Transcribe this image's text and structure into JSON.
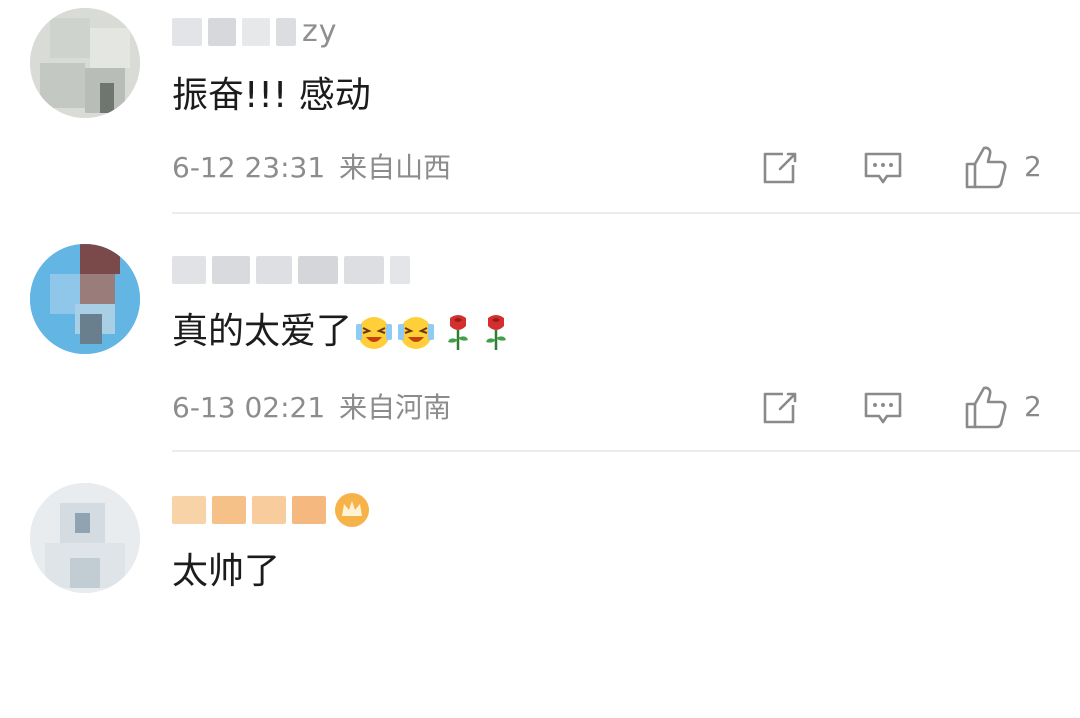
{
  "comments": [
    {
      "username_visible_suffix": "zy",
      "text": "振奋!!! 感动",
      "date": "6-12 23:31",
      "location": "来自山西",
      "likes": "2"
    },
    {
      "text": "真的太爱了",
      "date": "6-13 02:21",
      "location": "来自河南",
      "likes": "2"
    },
    {
      "text": "太帅了"
    }
  ],
  "icons": {
    "share": "share-icon",
    "reply": "comment-icon",
    "like": "thumbs-up-icon",
    "laugh_emoji": "laughing-crying-emoji",
    "rose": "rose-emoji",
    "vip_badge": "vip-crown-badge-icon"
  },
  "colors": {
    "text_primary": "#1c1c1c",
    "text_meta": "#8c8c8c",
    "icon_gray": "#8a8a8a",
    "divider": "#ececec",
    "vip_name": "#f5a15a"
  }
}
